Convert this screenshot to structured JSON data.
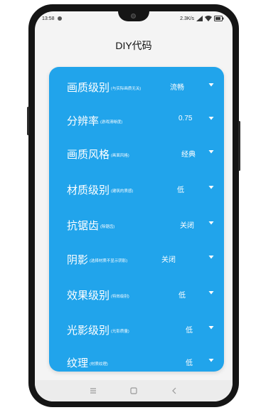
{
  "status": {
    "time": "13:58",
    "speed": "2.3K/s"
  },
  "page": {
    "title": "DIY代码"
  },
  "settings": [
    {
      "label": "画质级别",
      "note": "(与实际画质无关)",
      "value": "流畅"
    },
    {
      "label": "分辨率",
      "note": "(游戏清晰度)",
      "value": "0.75"
    },
    {
      "label": "画质风格",
      "note": "(画面风格)",
      "value": "经典"
    },
    {
      "label": "材质级别",
      "note": "(建筑的质感)",
      "value": "低"
    },
    {
      "label": "抗锯齿",
      "note": "(除锯齿)",
      "value": "关闭"
    },
    {
      "label": "阴影",
      "note": "(选择材质不显示阴影)",
      "value": "关闭"
    },
    {
      "label": "效果级别",
      "note": "(特效级别)",
      "value": "低"
    },
    {
      "label": "光影级别",
      "note": "(光影质量)",
      "value": "低"
    },
    {
      "label": "纹理",
      "note": "(材质纹理)",
      "value": "低"
    }
  ],
  "colors": {
    "panel": "#21a4eb",
    "text": "#ffffff"
  },
  "icons": [
    "signal-icon",
    "wifi-icon",
    "battery-icon",
    "dropdown-caret-icon",
    "menu-nav-icon",
    "home-nav-icon",
    "back-nav-icon"
  ]
}
